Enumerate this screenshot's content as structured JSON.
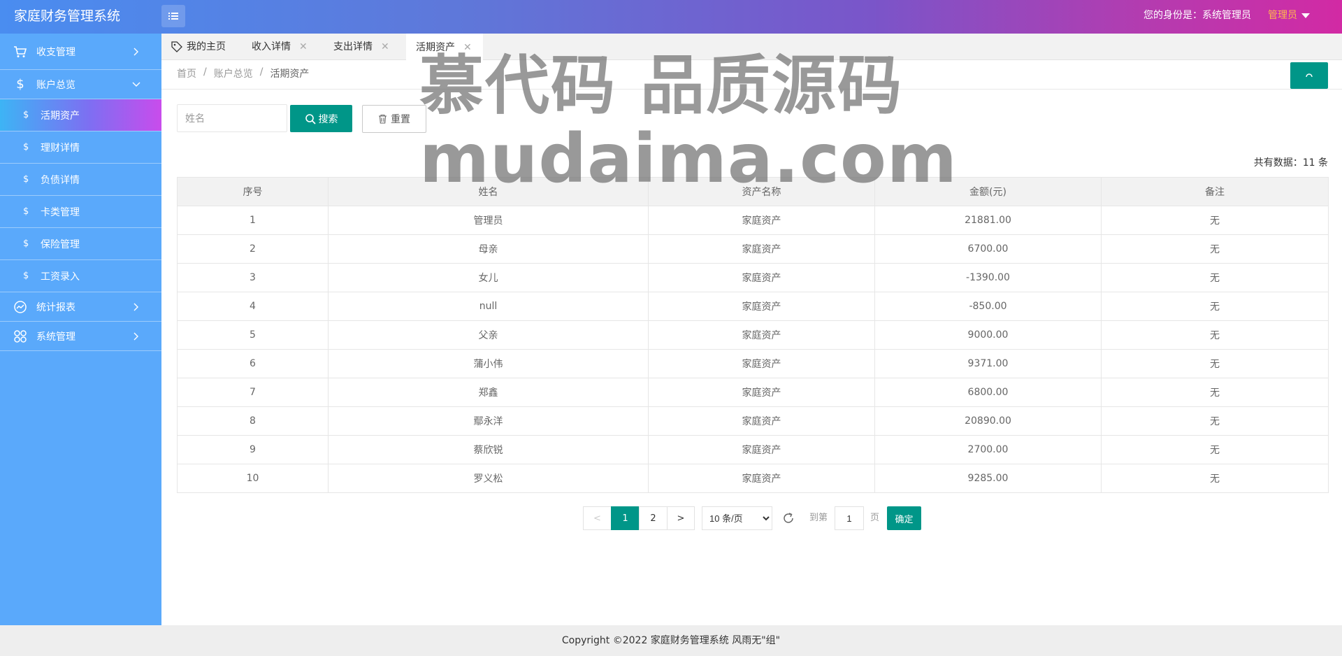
{
  "header": {
    "app_title": "家庭财务管理系统",
    "identity_text": "您的身份是：系统管理员",
    "user_name": "管理员"
  },
  "sidebar": {
    "items": [
      {
        "label": "收支管理",
        "icon": "cart-icon"
      },
      {
        "label": "账户总览",
        "icon": "dollar-icon"
      },
      {
        "label": "统计报表",
        "icon": "chart-icon"
      },
      {
        "label": "系统管理",
        "icon": "grid-icon"
      }
    ],
    "sub_items": [
      {
        "label": "活期资产",
        "icon": "$"
      },
      {
        "label": "理财详情",
        "icon": "$"
      },
      {
        "label": "负债详情",
        "icon": "$"
      },
      {
        "label": "卡类管理",
        "icon": "$"
      },
      {
        "label": "保险管理",
        "icon": "$"
      },
      {
        "label": "工资录入",
        "icon": "$"
      }
    ]
  },
  "tabs": [
    {
      "label": "我的主页"
    },
    {
      "label": "收入详情"
    },
    {
      "label": "支出详情"
    },
    {
      "label": "活期资产"
    }
  ],
  "breadcrumb": {
    "home": "首页",
    "sep": "/",
    "parent": "账户总览",
    "current": "活期资产"
  },
  "search": {
    "placeholder": "姓名",
    "search_label": "搜索",
    "reset_label": "重置"
  },
  "total_text": "共有数据：11 条",
  "table": {
    "headers": [
      "序号",
      "姓名",
      "资产名称",
      "金额(元)",
      "备注"
    ],
    "rows": [
      [
        "1",
        "管理员",
        "家庭资产",
        "21881.00",
        "无"
      ],
      [
        "2",
        "母亲",
        "家庭资产",
        "6700.00",
        "无"
      ],
      [
        "3",
        "女儿",
        "家庭资产",
        "-1390.00",
        "无"
      ],
      [
        "4",
        "null",
        "家庭资产",
        "-850.00",
        "无"
      ],
      [
        "5",
        "父亲",
        "家庭资产",
        "9000.00",
        "无"
      ],
      [
        "6",
        "蒲小伟",
        "家庭资产",
        "9371.00",
        "无"
      ],
      [
        "7",
        "郑鑫",
        "家庭资产",
        "6800.00",
        "无"
      ],
      [
        "8",
        "鄢永洋",
        "家庭资产",
        "20890.00",
        "无"
      ],
      [
        "9",
        "蔡欣锐",
        "家庭资产",
        "2700.00",
        "无"
      ],
      [
        "10",
        "罗义松",
        "家庭资产",
        "9285.00",
        "无"
      ]
    ]
  },
  "pager": {
    "prev": "<",
    "pages": [
      "1",
      "2"
    ],
    "next": ">",
    "page_size": "10 条/页",
    "goto_prefix": "到第",
    "goto_value": "1",
    "goto_suffix": "页",
    "confirm": "确定"
  },
  "watermark": {
    "line1": "慕代码 品质源码",
    "line2": "mudaima.com"
  },
  "footer": {
    "text": "Copyright ©2022 家庭财务管理系统 风雨无\"组\""
  },
  "colors": {
    "accent": "#009688",
    "sidebar": "#5aa9fb",
    "user_name": "#ffb84d"
  }
}
